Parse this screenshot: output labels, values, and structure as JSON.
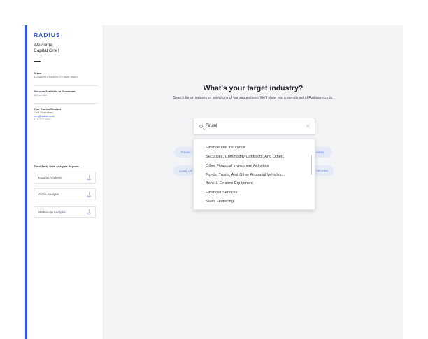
{
  "sidebar": {
    "logo": "RADIUS",
    "welcome_line1": "Welcome,",
    "welcome_line2": "Capital One!",
    "token_label": "Token",
    "token_value": "12348694 (Good for 23 more hours)",
    "records_label": "Records Available to Download",
    "records_value": "500 of 500",
    "contact_label": "Your Radius Contact",
    "contact_name": "Fred Rosenbert",
    "contact_email": "ven@radius.com",
    "contact_phone": "513-123-4567",
    "reports_title": "Third-Party Data Analysis Reports",
    "reports": [
      {
        "label": "Equifax Analysis"
      },
      {
        "label": "Acme Analysis"
      },
      {
        "label": "Globocorp Analysis"
      }
    ]
  },
  "main": {
    "title": "What's your target industry?",
    "subtitle": "Search for an industry or select one of our suggestions. We'll show you a sample set of Radius records.",
    "search": {
      "value": "Finan|"
    },
    "chips": [
      {
        "label": "Financ"
      },
      {
        "label": "ivities"
      },
      {
        "label": "Credit Int"
      },
      {
        "label": "Vehicles"
      }
    ],
    "dropdown": [
      "Finance and Insurance",
      "Securities, Commodity Contracts, And Other...",
      "Other Financial Investment Activities",
      "Funds, Trusts, And Other Financial Vehicles...",
      "Bank & Finance Equipment",
      "Financial Services",
      "Sales Financing"
    ]
  },
  "colors": {
    "accent": "#2f54eb",
    "chip_bg": "#e4eaf8",
    "chip_text": "#6f86d6",
    "canvas": "#f3f4f6"
  }
}
